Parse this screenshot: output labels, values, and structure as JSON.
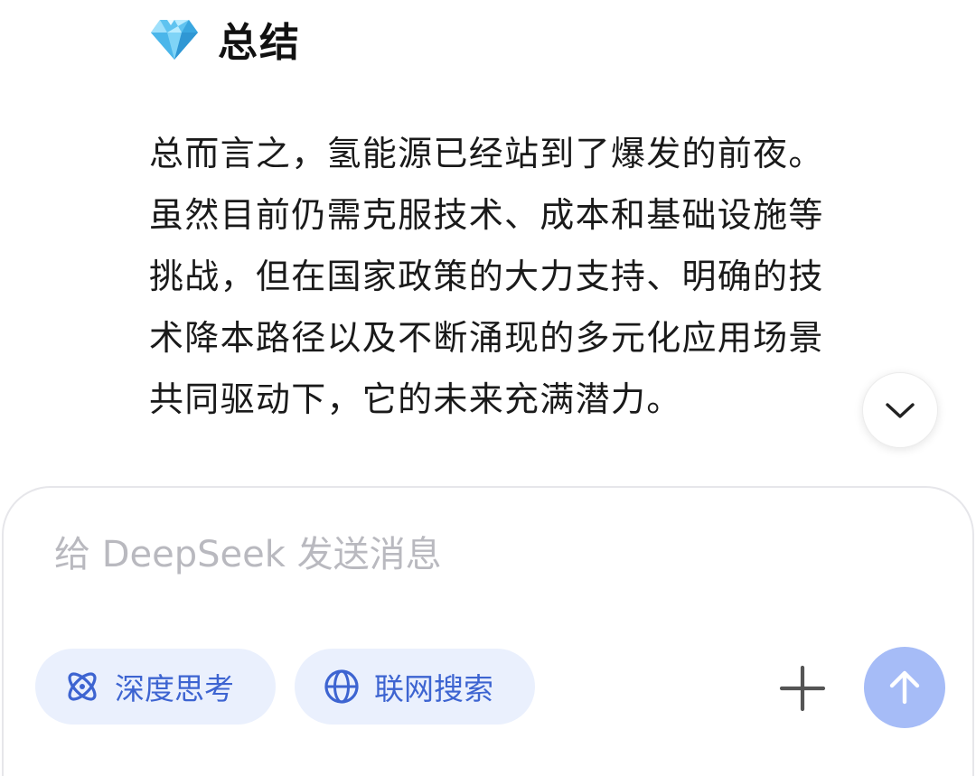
{
  "section": {
    "icon": "gem-icon",
    "title": "总结"
  },
  "summary": {
    "lines": [
      "总而言之，氢能源已经站到了爆发的前夜。",
      "虽然目前仍需克服技术、成本和基础设施等",
      "挑战，但在国家政策的大力支持、明确的技",
      "术降本路径以及不断涌现的多元化应用场景",
      "共同驱动下，它的未来充满潜力。"
    ]
  },
  "scroll_button": {
    "icon": "chevron-down-icon"
  },
  "composer": {
    "placeholder": "给 DeepSeek 发送消息",
    "value": "",
    "chips": {
      "deep_think": {
        "icon": "atom-icon",
        "label": "深度思考"
      },
      "web_search": {
        "icon": "globe-icon",
        "label": "联网搜索"
      }
    },
    "plus_icon": "plus-icon",
    "send_icon": "arrow-up-icon"
  },
  "colors": {
    "accent": "#3d64d1",
    "chip_bg": "#eaf0fd",
    "send_bg": "#a6bcf7",
    "text": "#1a1a1a",
    "placeholder": "#b9b9bf"
  }
}
